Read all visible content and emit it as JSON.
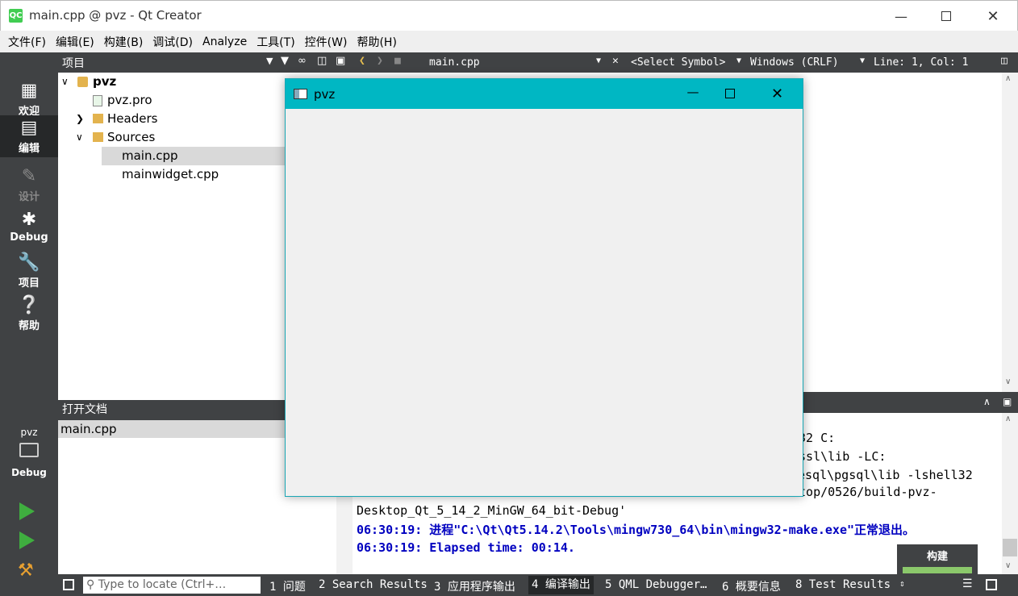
{
  "window": {
    "title": "main.cpp @ pvz - Qt Creator",
    "app_icon": "QC"
  },
  "menu": [
    "文件(F)",
    "编辑(E)",
    "构建(B)",
    "调试(D)",
    "Analyze",
    "工具(T)",
    "控件(W)",
    "帮助(H)"
  ],
  "modes": [
    {
      "label": "欢迎",
      "icon": "grid-icon"
    },
    {
      "label": "编辑",
      "icon": "edit-icon"
    },
    {
      "label": "设计",
      "icon": "pencil-icon"
    },
    {
      "label": "Debug",
      "icon": "bug-icon"
    },
    {
      "label": "项目",
      "icon": "wrench-icon"
    },
    {
      "label": "帮助",
      "icon": "help-icon"
    }
  ],
  "kit": {
    "project": "pvz",
    "config": "Debug"
  },
  "project_panel": {
    "title": "项目",
    "tree": [
      {
        "label": "pvz",
        "level": 0,
        "expanded": true,
        "bold": true
      },
      {
        "label": "pvz.pro",
        "level": 1
      },
      {
        "label": "Headers",
        "level": 1,
        "expanded": false
      },
      {
        "label": "Sources",
        "level": 1,
        "expanded": true
      },
      {
        "label": "main.cpp",
        "level": 2,
        "selected": true
      },
      {
        "label": "mainwidget.cpp",
        "level": 2
      }
    ]
  },
  "open_docs": {
    "title": "打开文档",
    "items": [
      "main.cpp"
    ]
  },
  "editor_toolbar": {
    "file": "main.cpp",
    "symbol": "<Select Symbol>",
    "line_ending": "Windows (CRLF)",
    "position": "Line: 1, Col: 1"
  },
  "output": {
    "lines": [
      {
        "text": "w32 C:",
        "style": "normal"
      },
      {
        "text": "nssl\\lib -LC:",
        "style": "normal"
      },
      {
        "text": "esql\\pgsql\\lib -lshell32",
        "style": "normal"
      },
      {
        "text": "ktop/0526/build-pvz-",
        "style": "normal"
      },
      {
        "text": "Desktop_Qt_5_14_2_MinGW_64_bit-Debug'",
        "style": "normal"
      },
      {
        "text": "06:30:19: 进程\"C:\\Qt\\Qt5.14.2\\Tools\\mingw730_64\\bin\\mingw32-make.exe\"正常退出。",
        "style": "blue"
      },
      {
        "text": "06:30:19: Elapsed time: 00:14.",
        "style": "blue"
      }
    ]
  },
  "build_indicator": {
    "label": "构建",
    "progress": 1.0
  },
  "status": {
    "locate_placeholder": "Type to locate (Ctrl+…",
    "tabs": [
      "1 问题",
      "2 Search Results",
      "3 应用程序输出",
      "4 编译输出",
      "5 QML Debugger…",
      "6 概要信息",
      "8 Test Results"
    ],
    "active_tab": 3
  },
  "pvz_window": {
    "title": "pvz"
  }
}
